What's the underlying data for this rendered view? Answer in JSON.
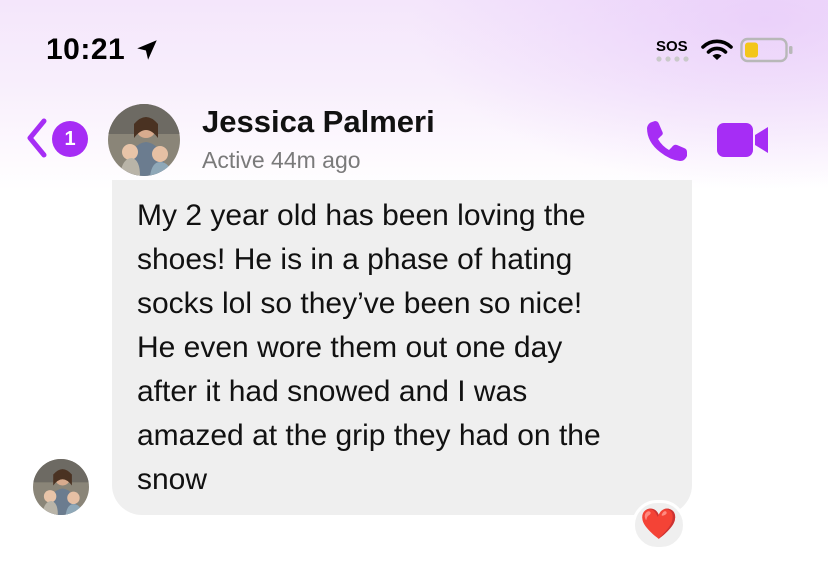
{
  "status_bar": {
    "time": "10:21",
    "sos": "SOS"
  },
  "header": {
    "back_count": "1",
    "contact_name": "Jessica Palmeri",
    "contact_status": "Active 44m ago",
    "accent_color": "#a62df5"
  },
  "message": {
    "text": "My 2 year old has been loving the\nshoes! He is in a phase of hating\nsocks lol so they’ve been so nice!\nHe even wore them out one day\nafter it had snowed and I was\namazed at the grip they had on the\nsnow",
    "reaction": "❤️"
  },
  "icons": [
    "location-arrow-icon",
    "wifi-icon",
    "battery-icon",
    "back-chevron-icon",
    "phone-icon",
    "video-camera-icon"
  ]
}
